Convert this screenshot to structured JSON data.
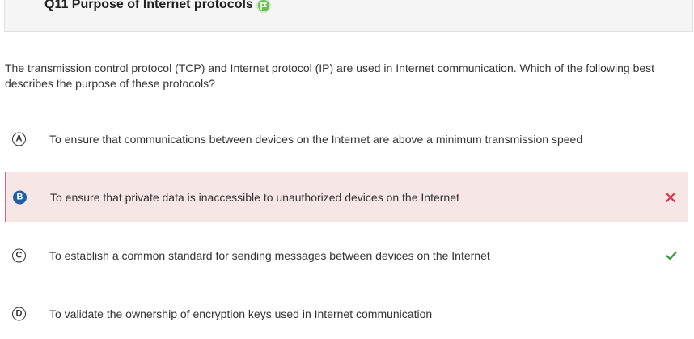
{
  "header": {
    "title": "Q11 Purpose of Internet protocols",
    "badge_icon": "flag-icon"
  },
  "question": "The transmission control protocol (TCP) and Internet protocol (IP) are used in Internet communication. Which of the following best describes the purpose of these protocols?",
  "choices": [
    {
      "letter": "A",
      "text": "To ensure that communications between devices on the Internet are above a minimum transmission speed",
      "state": "none"
    },
    {
      "letter": "B",
      "text": "To ensure that private data is inaccessible to unauthorized devices on the Internet",
      "state": "selected-incorrect",
      "mark_icon": "x-icon"
    },
    {
      "letter": "C",
      "text": "To establish a common standard for sending messages between devices on the Internet",
      "state": "correct",
      "mark_icon": "check-icon"
    },
    {
      "letter": "D",
      "text": "To validate the ownership of encryption keys used in Internet communication",
      "state": "none"
    }
  ],
  "colors": {
    "incorrect": "#d9344d",
    "correct": "#3c9a3c",
    "selected_bg": "#f6e6e6",
    "selected_letter": "#1f5fa8"
  }
}
